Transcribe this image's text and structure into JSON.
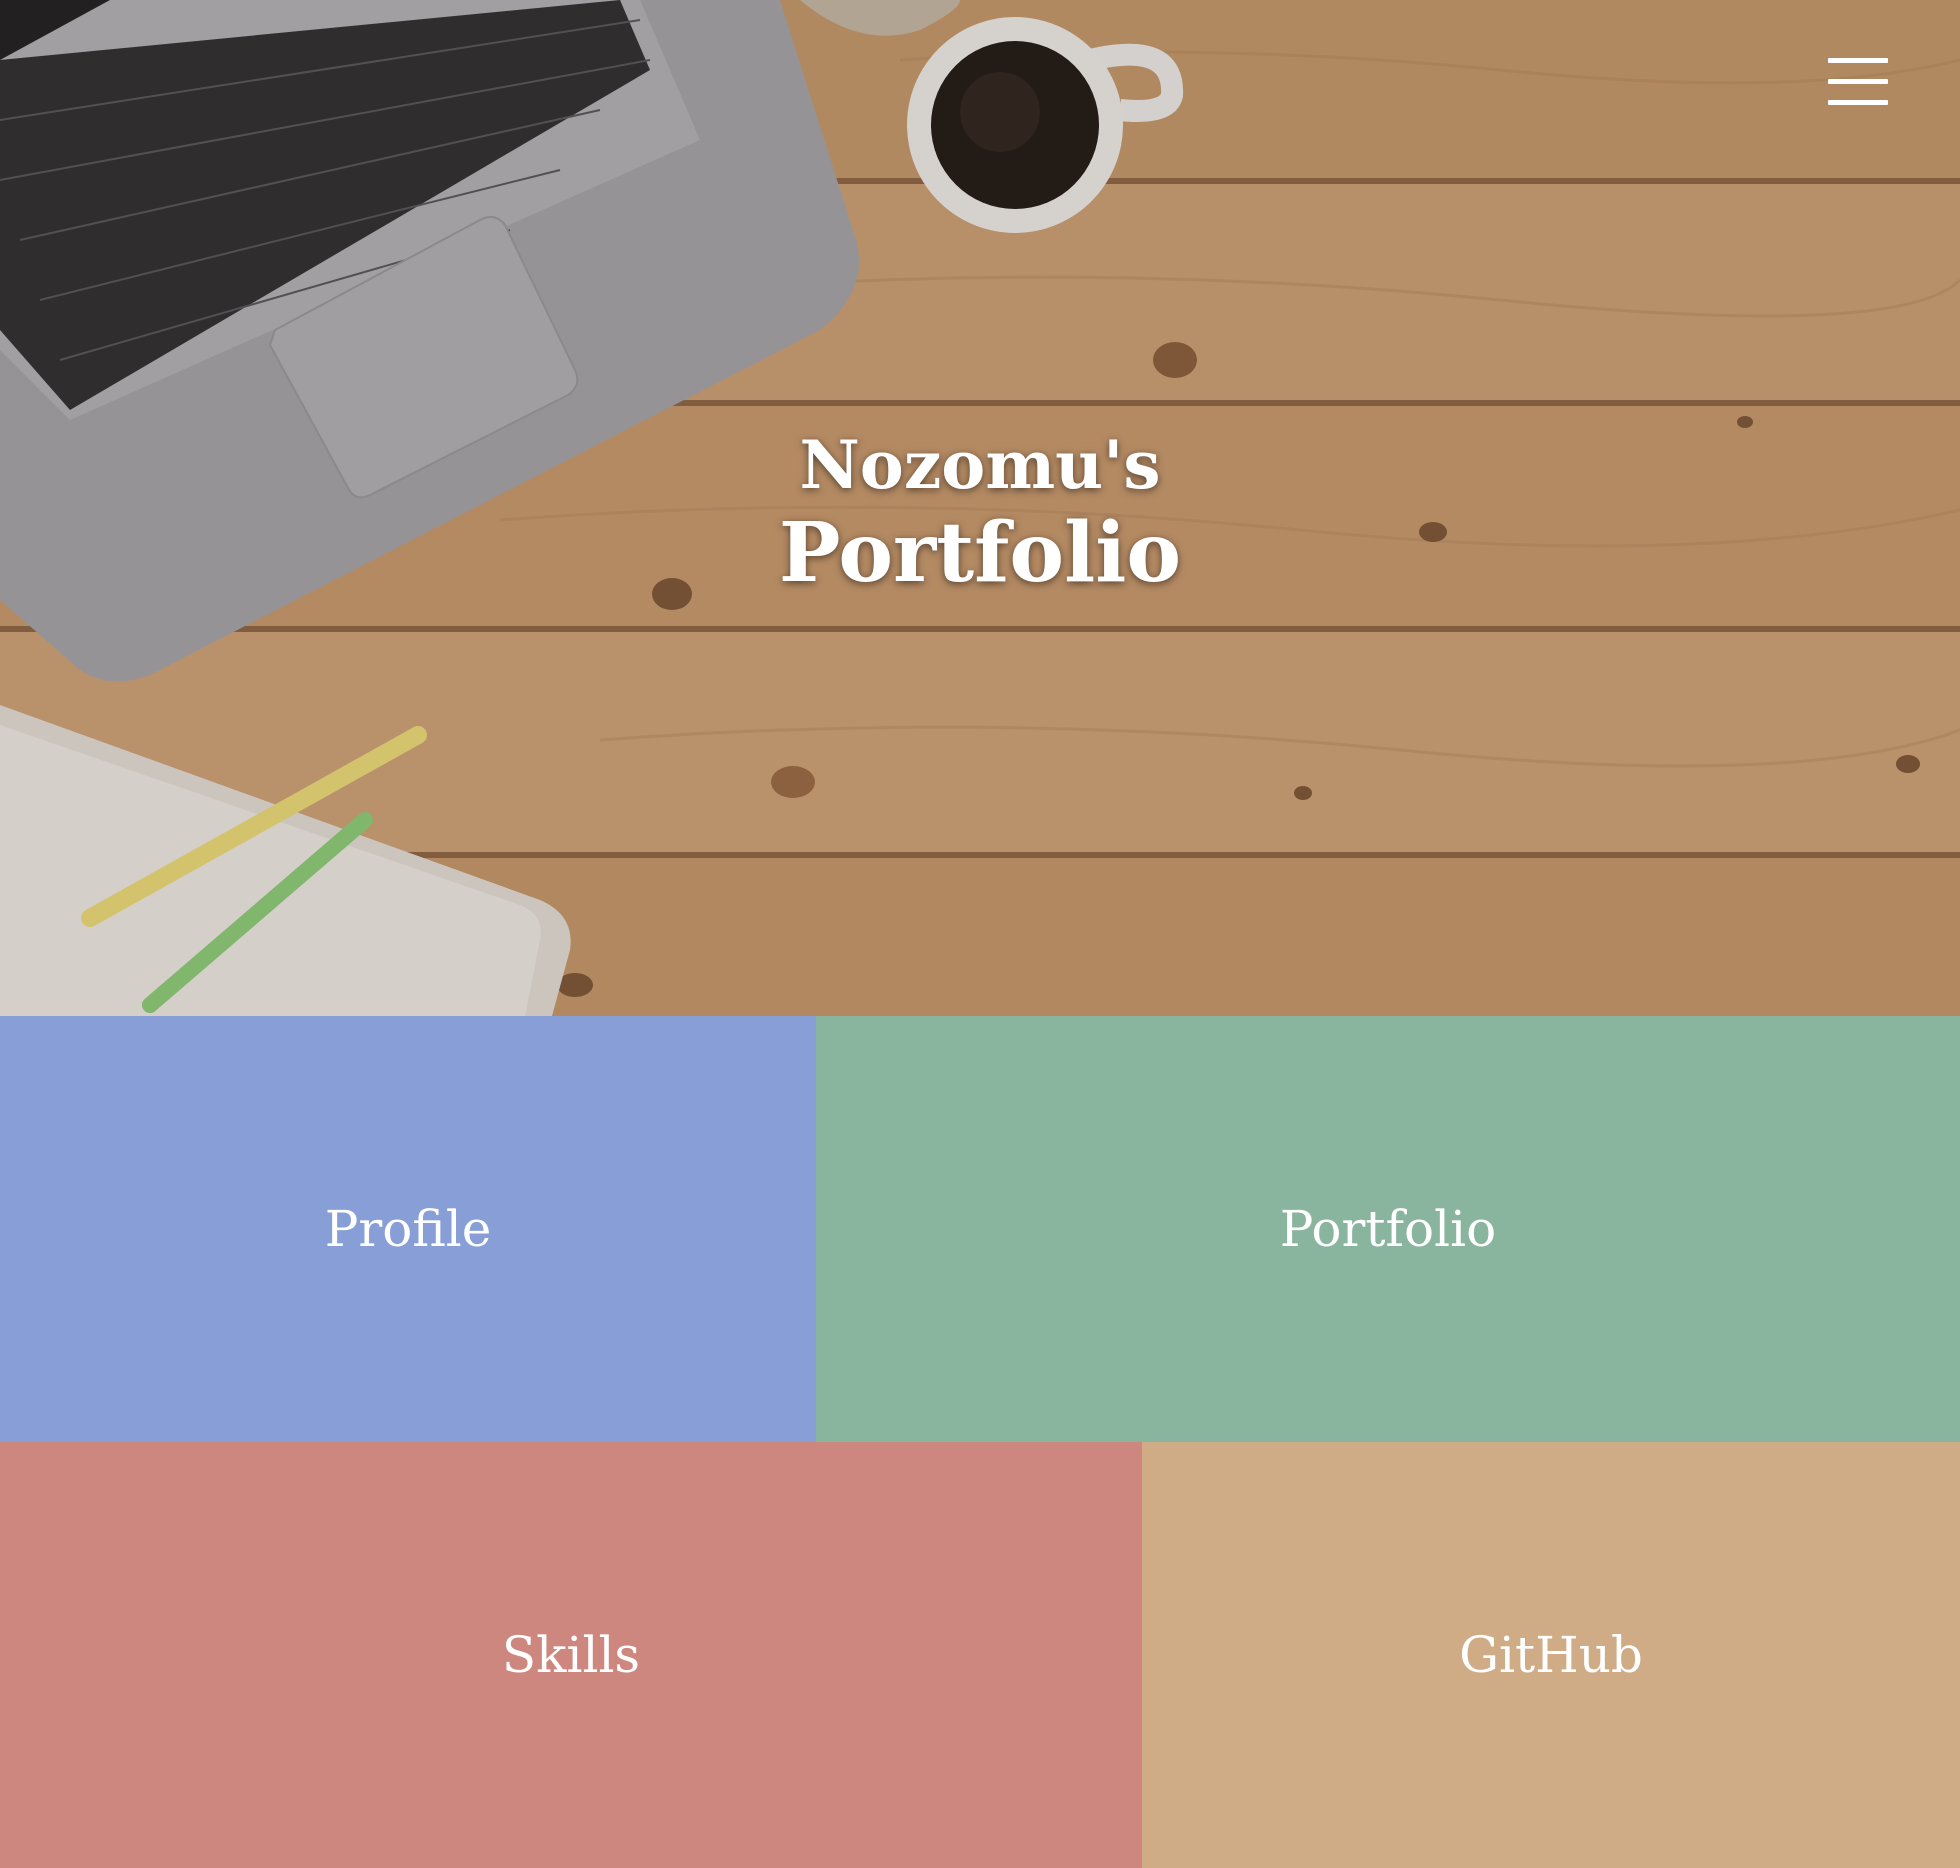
{
  "hero": {
    "title_line1": "Nozomu's",
    "title_line2": "Portfolio",
    "background": "photo: laptop, coffee cup, notebook and straws on wooden desk"
  },
  "menu": {
    "icon": "hamburger-menu-icon"
  },
  "tiles": [
    {
      "label": "Profile",
      "color": "#879ed6"
    },
    {
      "label": "Portfolio",
      "color": "#89b59e"
    },
    {
      "label": "Skills",
      "color": "#cd877f"
    },
    {
      "label": "GitHub",
      "color": "#cfac86"
    }
  ]
}
